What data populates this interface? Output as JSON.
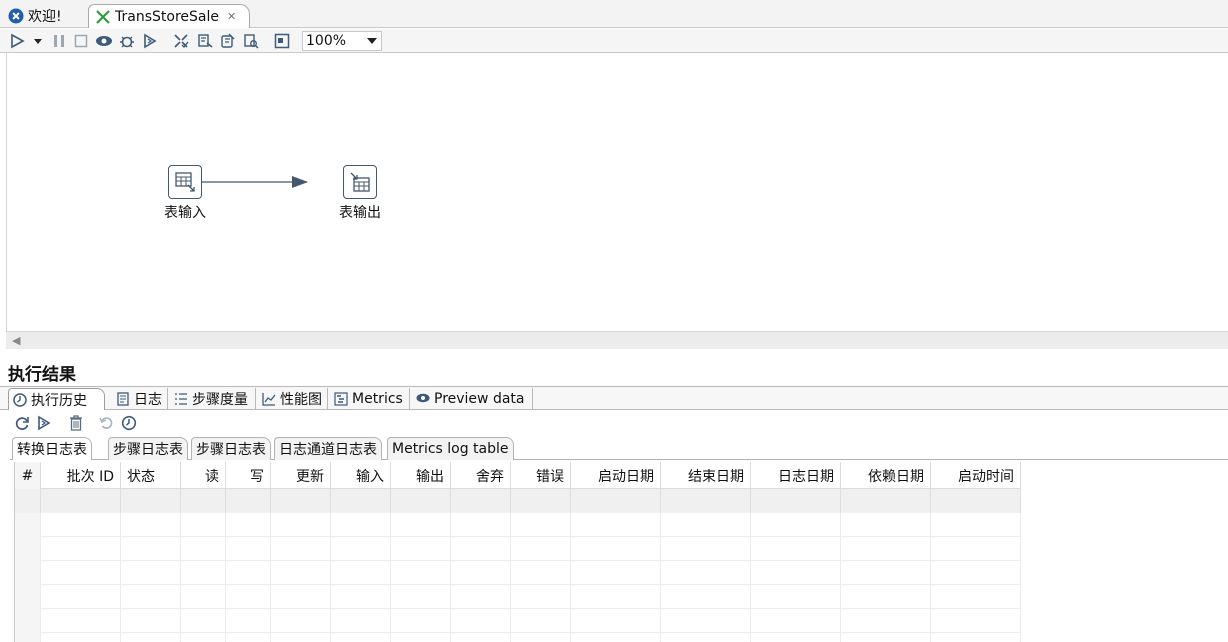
{
  "editor_tabs": [
    {
      "label": "欢迎!",
      "icon": "spoon-logo-icon"
    },
    {
      "label": "TransStoreSale",
      "icon": "transformation-icon"
    }
  ],
  "toolbar": {
    "icons": [
      "run-icon",
      "run-dropdown-icon",
      "pause-icon",
      "stop-icon",
      "preview-icon",
      "debug-icon",
      "replay-icon",
      "verify-icon",
      "analyze-impact-icon",
      "sql-icon",
      "explore-db-icon",
      "show-results-icon"
    ],
    "zoom_value": "100%"
  },
  "canvas": {
    "steps": [
      {
        "label": "表输入",
        "icon": "table-input-icon"
      },
      {
        "label": "表输出",
        "icon": "table-output-icon"
      }
    ],
    "hop_color": "#44586b"
  },
  "results": {
    "title": "执行结果",
    "tabs": [
      {
        "label": "执行历史",
        "icon": "history-icon"
      },
      {
        "label": "日志",
        "icon": "log-icon"
      },
      {
        "label": "步骤度量",
        "icon": "step-metrics-icon"
      },
      {
        "label": "性能图",
        "icon": "performance-chart-icon"
      },
      {
        "label": "Metrics",
        "icon": "metrics-icon"
      },
      {
        "label": "Preview data",
        "icon": "preview-icon"
      }
    ],
    "tool_icons": [
      "refresh-icon",
      "replay-log-icon",
      "delete-icon",
      "undo-icon",
      "history-clock-icon"
    ],
    "log_tabs": [
      "转换日志表",
      "步骤日志表",
      "步骤日志表",
      "日志通道日志表",
      "Metrics log table"
    ],
    "table": {
      "columns": [
        "#",
        "批次 ID",
        "状态",
        "读",
        "写",
        "更新",
        "输入",
        "输出",
        "舍弃",
        "错误",
        "启动日期",
        "结束日期",
        "日志日期",
        "依赖日期",
        "启动时间"
      ],
      "rows": []
    }
  }
}
